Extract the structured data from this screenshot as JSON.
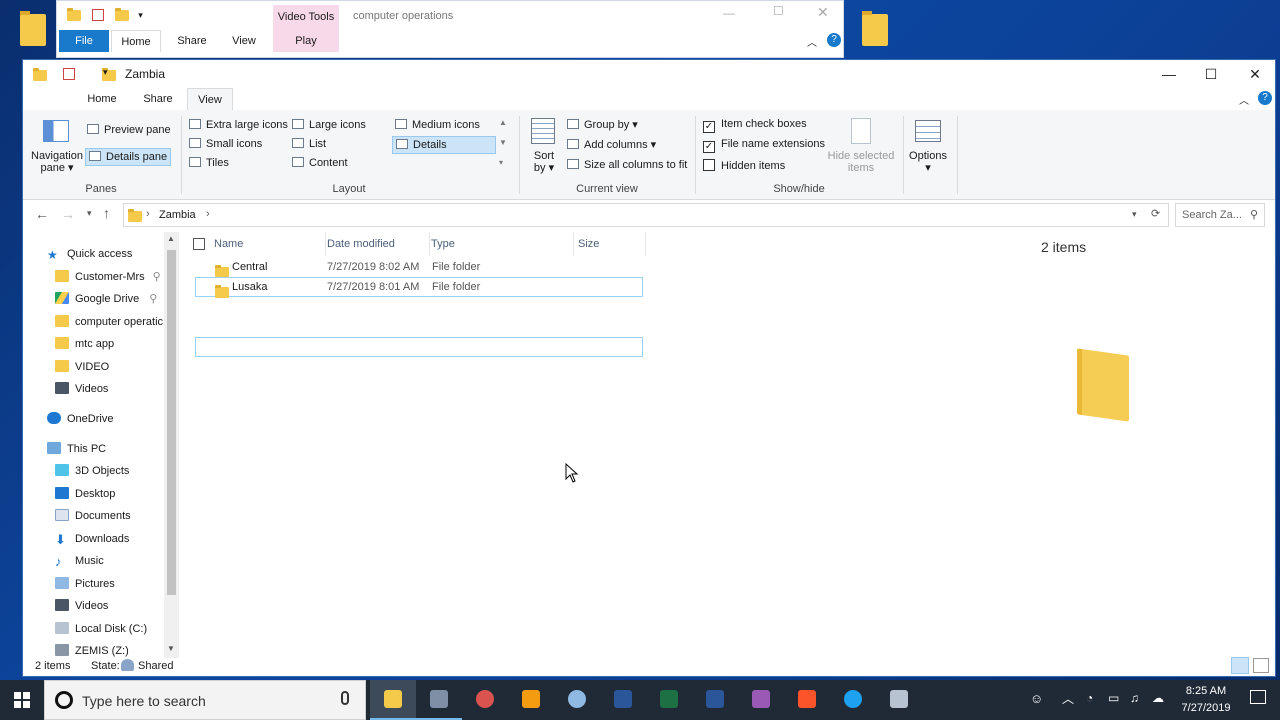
{
  "back_window": {
    "title": "computer operations",
    "context_tab": "Video Tools",
    "tabs": [
      "File",
      "Home",
      "Share",
      "View"
    ],
    "context_subtab": "Play"
  },
  "window": {
    "title": "Zambia",
    "tabs": [
      "Home",
      "Share",
      "View"
    ],
    "active_tab": "View"
  },
  "ribbon": {
    "panes": {
      "label": "Panes",
      "navigation_pane": "Navigation pane",
      "preview_pane": "Preview pane",
      "details_pane": "Details pane"
    },
    "layout": {
      "label": "Layout",
      "items": [
        "Extra large icons",
        "Large icons",
        "Medium icons",
        "Small icons",
        "List",
        "Details",
        "Tiles",
        "Content"
      ]
    },
    "current_view": {
      "label": "Current view",
      "sort_by": "Sort by",
      "group_by": "Group by",
      "add_columns": "Add columns",
      "size_all_columns": "Size all columns to fit"
    },
    "show_hide": {
      "label": "Show/hide",
      "item_check_boxes": "Item check boxes",
      "file_name_extensions": "File name extensions",
      "hidden_items": "Hidden items",
      "hide_selected_items": "Hide selected items"
    },
    "options": "Options"
  },
  "address": {
    "path": "Zambia",
    "search_placeholder": "Search Za..."
  },
  "nav": {
    "quick_access": "Quick access",
    "quick_items": [
      "Customer-Mrs",
      "Google Drive",
      "computer operatic",
      "mtc app",
      "VIDEO",
      "Videos"
    ],
    "onedrive": "OneDrive",
    "this_pc": "This PC",
    "pc_items": [
      "3D Objects",
      "Desktop",
      "Documents",
      "Downloads",
      "Music",
      "Pictures",
      "Videos",
      "Local Disk (C:)",
      "ZEMIS (Z:)"
    ]
  },
  "columns": [
    "Name",
    "Date modified",
    "Type",
    "Size"
  ],
  "rows": [
    {
      "name": "Central",
      "date": "7/27/2019 8:02 AM",
      "type": "File folder",
      "size": ""
    },
    {
      "name": "Lusaka",
      "date": "7/27/2019 8:01 AM",
      "type": "File folder",
      "size": ""
    }
  ],
  "preview": {
    "count": "2 items"
  },
  "status": {
    "items": "2 items",
    "state_label": "State:",
    "state_value": "Shared"
  },
  "taskbar": {
    "search_placeholder": "Type here to search",
    "time": "8:25 AM",
    "date": "7/27/2019"
  },
  "colors": {
    "accent": "#0078d7",
    "folder": "#f5c94a",
    "selection_border": "#99d1ff",
    "taskbar": "#1f2a36"
  }
}
